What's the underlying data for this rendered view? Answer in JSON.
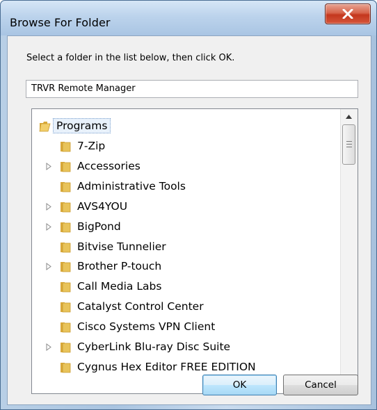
{
  "window": {
    "title": "Browse For Folder",
    "close_icon": "close-x-icon"
  },
  "dialog": {
    "instruction": "Select a folder in the list below, then click OK.",
    "folder_value": "TRVR Remote Manager"
  },
  "tree": {
    "root": {
      "label": "Programs",
      "selected": true,
      "expanded": true
    },
    "items": [
      {
        "label": "7-Zip",
        "has_children": false
      },
      {
        "label": "Accessories",
        "has_children": true
      },
      {
        "label": "Administrative Tools",
        "has_children": false
      },
      {
        "label": "AVS4YOU",
        "has_children": true
      },
      {
        "label": "BigPond",
        "has_children": true
      },
      {
        "label": "Bitvise Tunnelier",
        "has_children": false
      },
      {
        "label": "Brother P-touch",
        "has_children": true
      },
      {
        "label": "Call Media Labs",
        "has_children": false
      },
      {
        "label": "Catalyst Control Center",
        "has_children": false
      },
      {
        "label": "Cisco Systems VPN Client",
        "has_children": false
      },
      {
        "label": "CyberLink Blu-ray Disc Suite",
        "has_children": true
      },
      {
        "label": "Cygnus Hex Editor FREE EDITION",
        "has_children": false
      }
    ]
  },
  "buttons": {
    "ok": "OK",
    "cancel": "Cancel"
  },
  "colors": {
    "title_bar": "#bcd3ec",
    "close_button": "#c4371e",
    "folder": "#e8c35a",
    "selection_border": "#7da2ce"
  }
}
